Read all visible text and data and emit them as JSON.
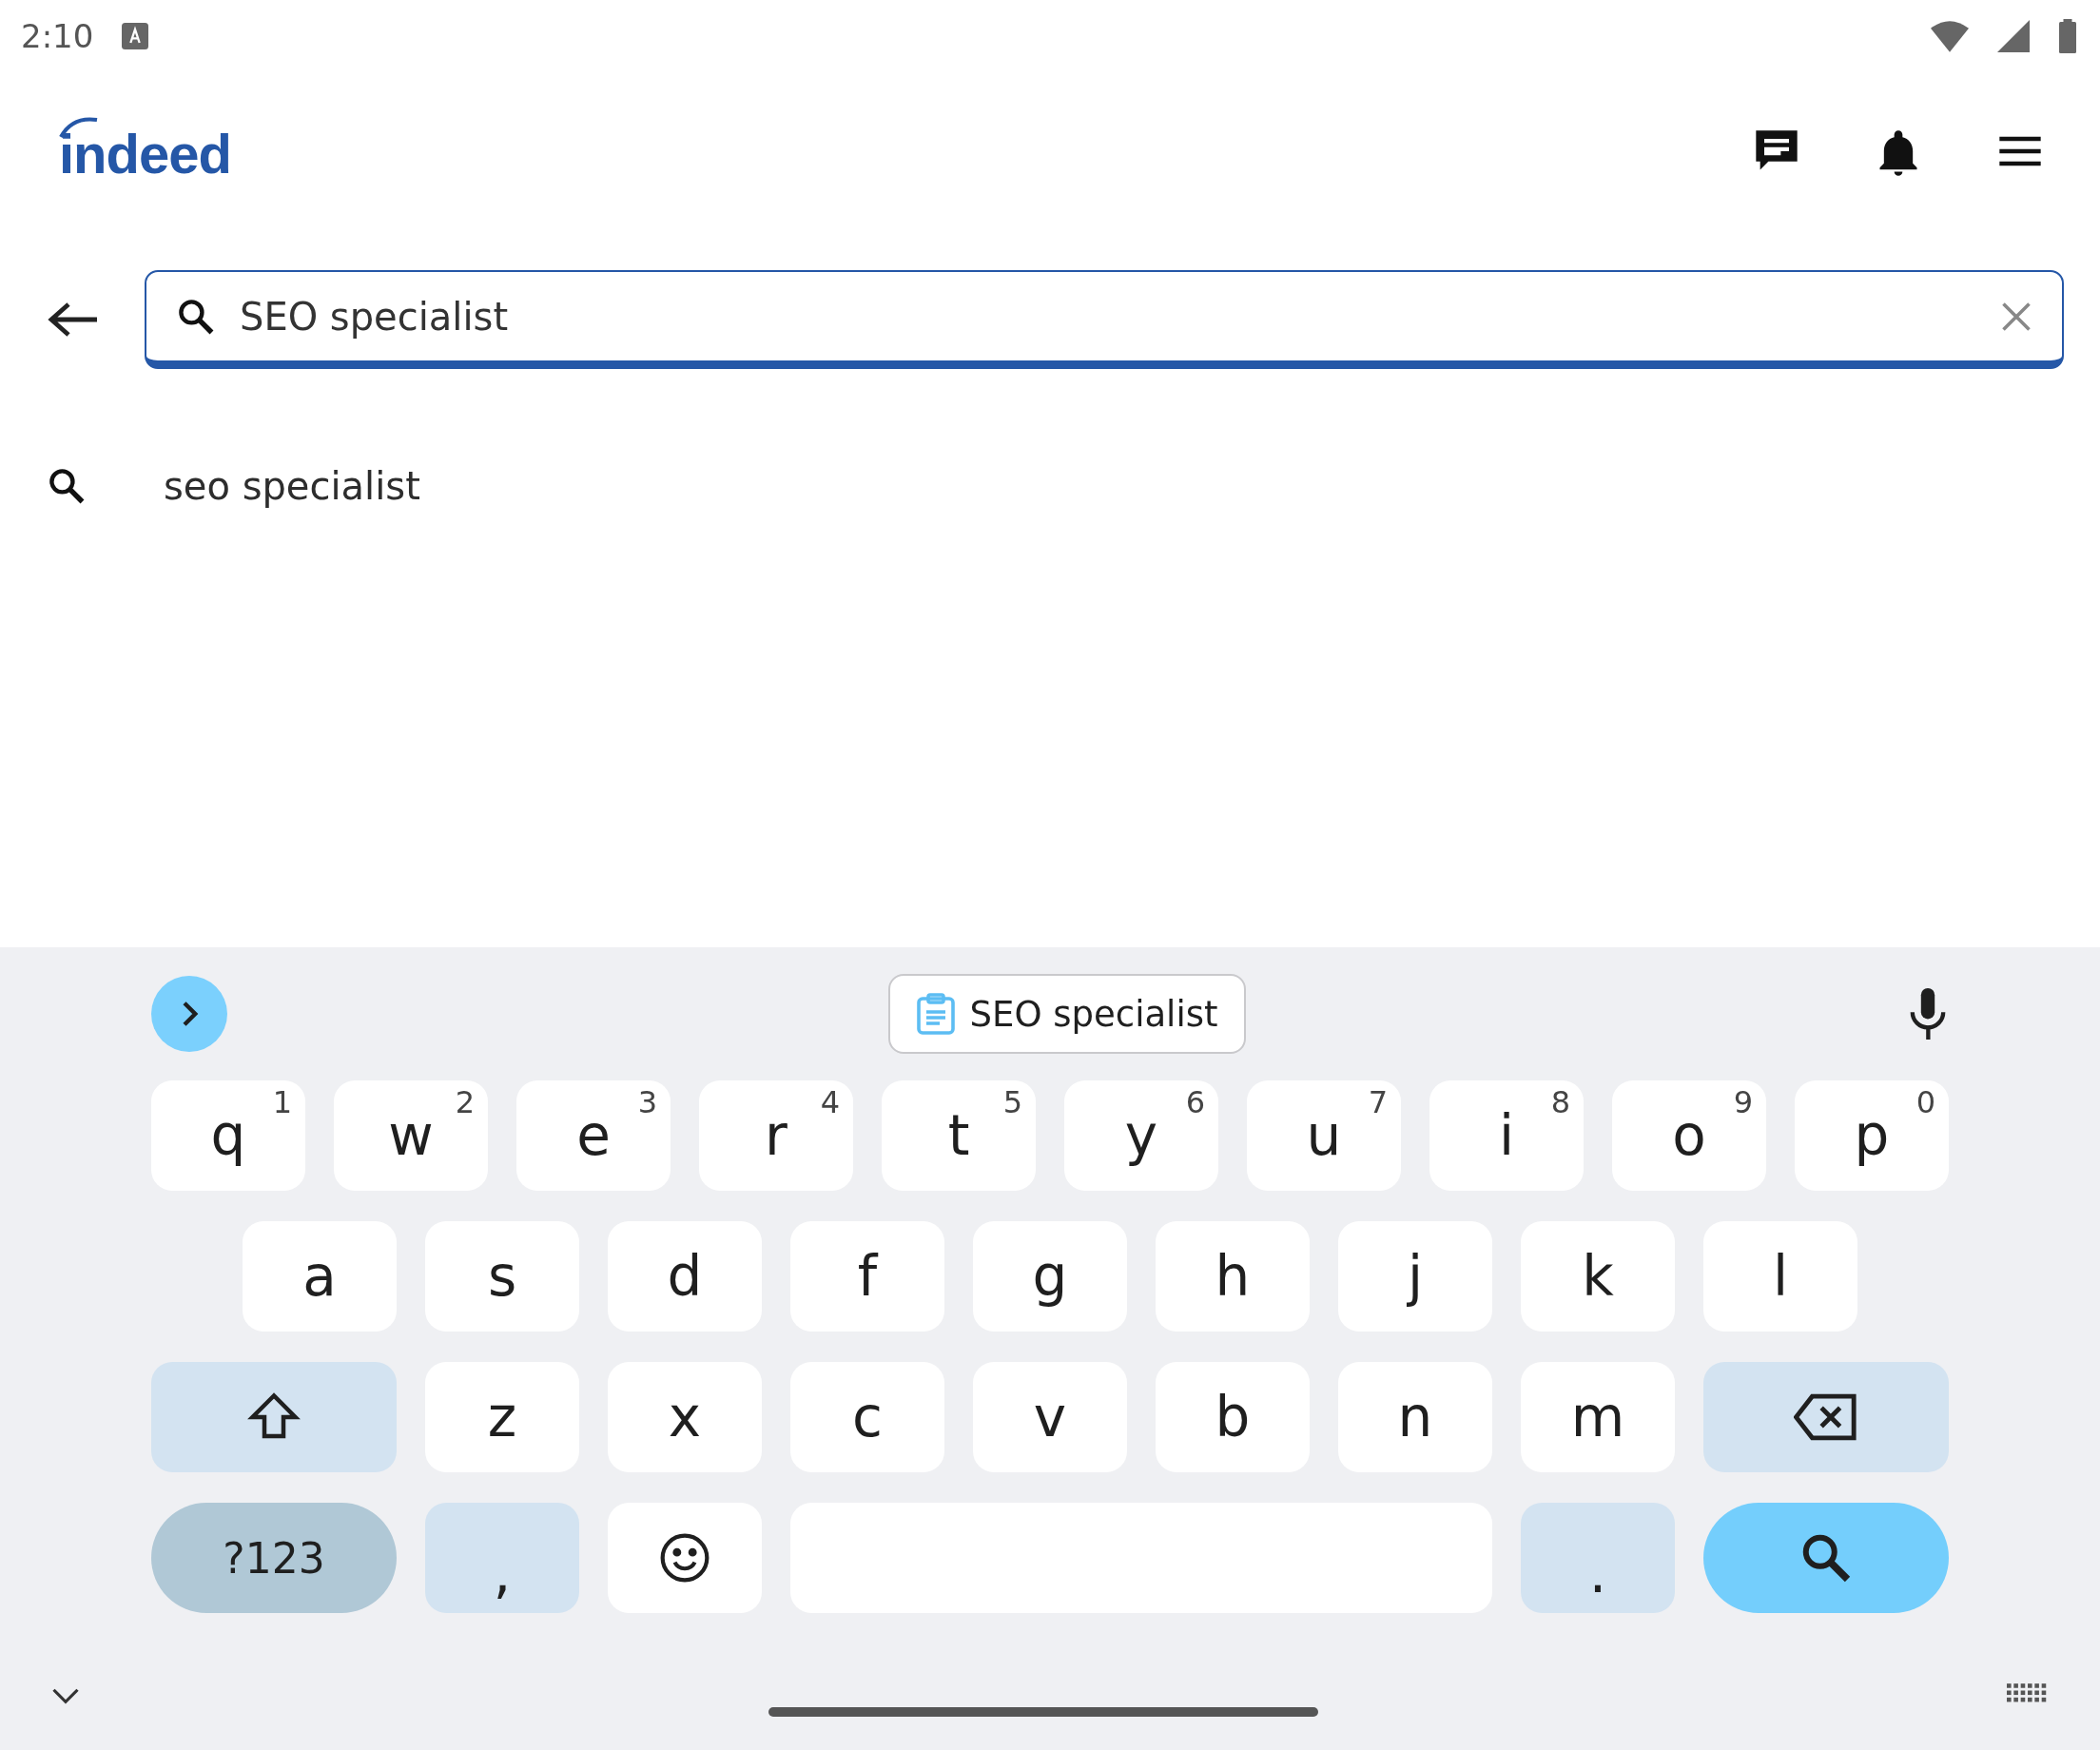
{
  "status_bar": {
    "time": "2:10"
  },
  "header": {
    "logo": "indeed"
  },
  "search": {
    "value": "SEO specialist"
  },
  "suggestions": [
    {
      "text": "seo specialist"
    }
  ],
  "keyboard": {
    "clipboard_chip": "SEO specialist",
    "rows": [
      {
        "keys": [
          {
            "kind": "letter",
            "label": "q",
            "hint": "1"
          },
          {
            "kind": "letter",
            "label": "w",
            "hint": "2"
          },
          {
            "kind": "letter",
            "label": "e",
            "hint": "3"
          },
          {
            "kind": "letter",
            "label": "r",
            "hint": "4"
          },
          {
            "kind": "letter",
            "label": "t",
            "hint": "5"
          },
          {
            "kind": "letter",
            "label": "y",
            "hint": "6"
          },
          {
            "kind": "letter",
            "label": "u",
            "hint": "7"
          },
          {
            "kind": "letter",
            "label": "i",
            "hint": "8"
          },
          {
            "kind": "letter",
            "label": "o",
            "hint": "9"
          },
          {
            "kind": "letter",
            "label": "p",
            "hint": "0"
          }
        ]
      },
      {
        "keys": [
          {
            "kind": "letter",
            "label": "a"
          },
          {
            "kind": "letter",
            "label": "s"
          },
          {
            "kind": "letter",
            "label": "d"
          },
          {
            "kind": "letter",
            "label": "f"
          },
          {
            "kind": "letter",
            "label": "g"
          },
          {
            "kind": "letter",
            "label": "h"
          },
          {
            "kind": "letter",
            "label": "j"
          },
          {
            "kind": "letter",
            "label": "k"
          },
          {
            "kind": "letter",
            "label": "l"
          }
        ]
      },
      {
        "keys": [
          {
            "kind": "shift"
          },
          {
            "kind": "letter",
            "label": "z"
          },
          {
            "kind": "letter",
            "label": "x"
          },
          {
            "kind": "letter",
            "label": "c"
          },
          {
            "kind": "letter",
            "label": "v"
          },
          {
            "kind": "letter",
            "label": "b"
          },
          {
            "kind": "letter",
            "label": "n"
          },
          {
            "kind": "letter",
            "label": "m"
          },
          {
            "kind": "backspace"
          }
        ]
      },
      {
        "keys": [
          {
            "kind": "symbols",
            "label": "?123"
          },
          {
            "kind": "punct",
            "label": ","
          },
          {
            "kind": "emoji"
          },
          {
            "kind": "space"
          },
          {
            "kind": "punct",
            "label": "."
          },
          {
            "kind": "search"
          }
        ]
      }
    ]
  }
}
